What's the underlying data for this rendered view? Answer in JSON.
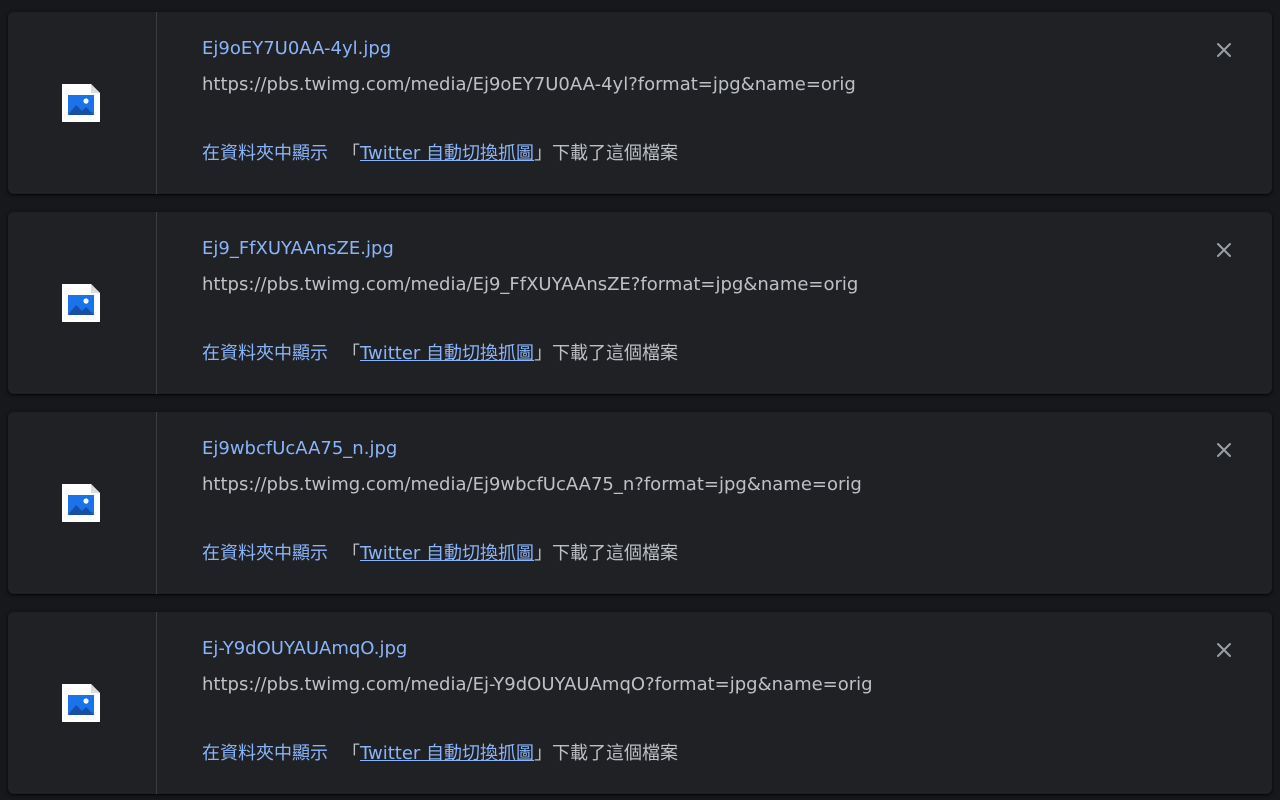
{
  "downloads": [
    {
      "file_name": "Ej9oEY7U0AA-4yl.jpg",
      "url": "https://pbs.twimg.com/media/Ej9oEY7U0AA-4yl?format=jpg&name=orig",
      "show_in_folder": "在資料夾中顯示",
      "by_prefix": "「",
      "extension_name": "Twitter 自動切換抓圖",
      "by_suffix": "」下載了這個檔案"
    },
    {
      "file_name": "Ej9_FfXUYAAnsZE.jpg",
      "url": "https://pbs.twimg.com/media/Ej9_FfXUYAAnsZE?format=jpg&name=orig",
      "show_in_folder": "在資料夾中顯示",
      "by_prefix": "「",
      "extension_name": "Twitter 自動切換抓圖",
      "by_suffix": "」下載了這個檔案"
    },
    {
      "file_name": "Ej9wbcfUcAA75_n.jpg",
      "url": "https://pbs.twimg.com/media/Ej9wbcfUcAA75_n?format=jpg&name=orig",
      "show_in_folder": "在資料夾中顯示",
      "by_prefix": "「",
      "extension_name": "Twitter 自動切換抓圖",
      "by_suffix": "」下載了這個檔案"
    },
    {
      "file_name": "Ej-Y9dOUYAUAmqO.jpg",
      "url": "https://pbs.twimg.com/media/Ej-Y9dOUYAUAmqO?format=jpg&name=orig",
      "show_in_folder": "在資料夾中顯示",
      "by_prefix": "「",
      "extension_name": "Twitter 自動切換抓圖",
      "by_suffix": "」下載了這個檔案"
    }
  ],
  "icons": {
    "file": "image-file-icon",
    "remove": "close-icon"
  },
  "colors": {
    "background": "#17181b",
    "card": "#202124",
    "link": "#8ab4f8",
    "text": "#bdc1c6",
    "icon": "#9aa0a6"
  }
}
